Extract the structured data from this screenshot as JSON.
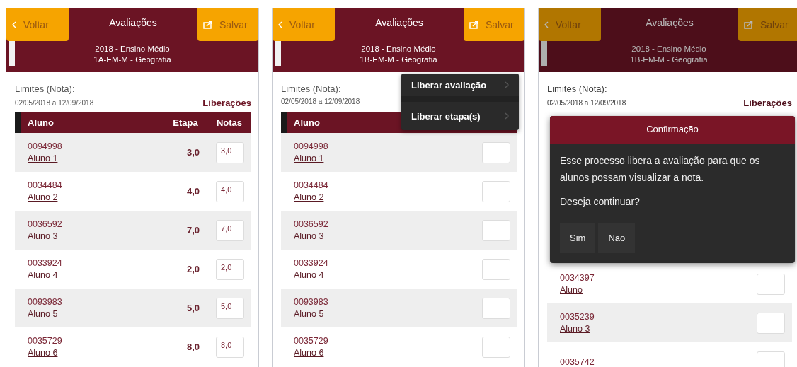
{
  "screens": [
    {
      "header": {
        "back": "Voltar",
        "title": "Avaliações",
        "save": "Salvar"
      },
      "subtitle": [
        "2018 - Ensino Médio",
        "1A-EM-M - Geografia"
      ],
      "limits_label": "Limites (Nota):",
      "date_range": "02/05/2018 a 12/09/2018",
      "link": "Liberações",
      "dimmed": false,
      "columns": [
        "Aluno",
        "Etapa",
        "Notas"
      ],
      "rows": [
        {
          "id": "0094998",
          "name": "Aluno 1",
          "etapa": "3,0",
          "nota": "3,0",
          "shaded": true
        },
        {
          "id": "0034484",
          "name": "Aluno 2",
          "etapa": "4,0",
          "nota": "4,0",
          "shaded": false
        },
        {
          "id": "0036592",
          "name": "Aluno 3",
          "etapa": "7,0",
          "nota": "7,0",
          "shaded": true
        },
        {
          "id": "0033924",
          "name": "Aluno 4",
          "etapa": "2,0",
          "nota": "2,0",
          "shaded": false
        },
        {
          "id": "0093983",
          "name": "Aluno 5",
          "etapa": "5,0",
          "nota": "5,0",
          "shaded": true
        },
        {
          "id": "0035729",
          "name": "Aluno 6",
          "etapa": "8,0",
          "nota": "8,0",
          "shaded": false
        }
      ],
      "overlay": {
        "kind": "none"
      }
    },
    {
      "header": {
        "back": "Voltar",
        "title": "Avaliações",
        "save": "Salvar"
      },
      "subtitle": [
        "2018 - Ensino Médio",
        "1B-EM-M - Geografia"
      ],
      "limits_label": "Limites (Nota):",
      "date_range": "02/05/2018 a 12/09/2018",
      "dimmed": false,
      "columns": [
        "Aluno"
      ],
      "rows": [
        {
          "id": "0094998",
          "name": "Aluno 1",
          "shaded": true
        },
        {
          "id": "0034484",
          "name": "Aluno 2",
          "shaded": false
        },
        {
          "id": "0036592",
          "name": "Aluno 3",
          "shaded": true
        },
        {
          "id": "0033924",
          "name": "Aluno 4",
          "shaded": false
        },
        {
          "id": "0093983",
          "name": "Aluno 5",
          "shaded": true
        },
        {
          "id": "0035729",
          "name": "Aluno 6",
          "shaded": false
        }
      ],
      "overlay": {
        "kind": "menu",
        "items": [
          "Liberar avaliação",
          "Liberar etapa(s)"
        ]
      }
    },
    {
      "header": {
        "back": "Voltar",
        "title": "Avaliações",
        "save": "Salvar"
      },
      "subtitle": [
        "2018 - Ensino Médio",
        "1B-EM-M - Geografia"
      ],
      "limits_label": "Limites (Nota):",
      "date_range": "02/05/2018 a 12/09/2018",
      "link": "Liberações",
      "dimmed": true,
      "rows": [
        {
          "id": "0034397",
          "name": "Aluno",
          "shaded": false
        },
        {
          "id": "0035239",
          "name": "Aluno 3",
          "shaded": true
        },
        {
          "id": "0035742",
          "shaded": false
        }
      ],
      "overlay": {
        "kind": "dialog",
        "title": "Confirmação",
        "message": "Esse processo libera a avaliação para que os alunos possam visualizar a nota.",
        "question": "Deseja continuar?",
        "buttons": [
          "Sim",
          "Não"
        ]
      }
    }
  ]
}
